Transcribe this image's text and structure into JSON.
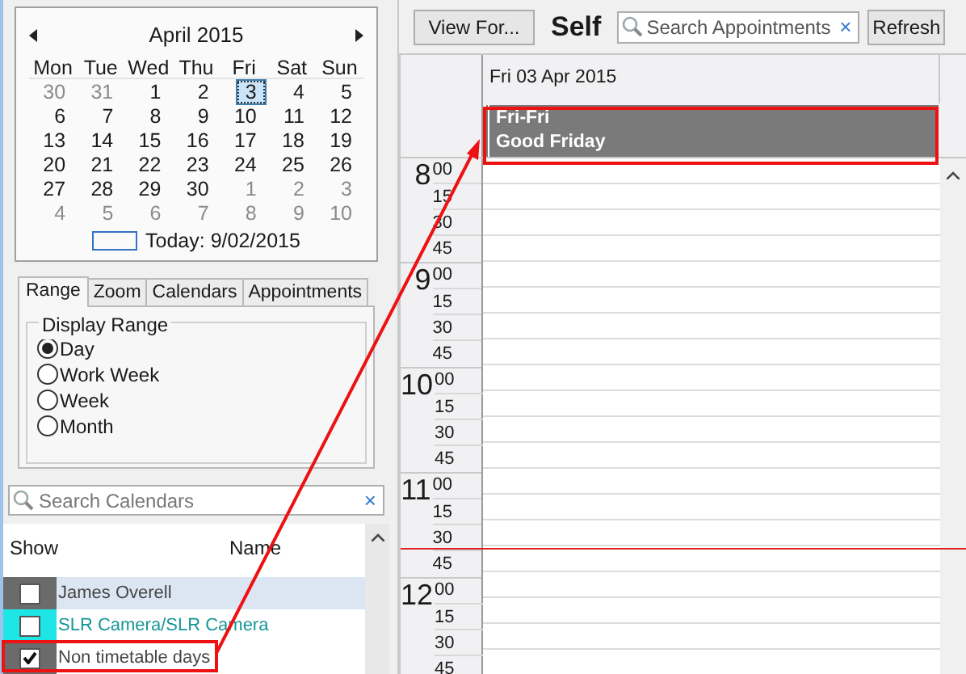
{
  "mini_calendar": {
    "month_label": "April 2015",
    "weekdays": [
      "Mon",
      "Tue",
      "Wed",
      "Thu",
      "Fri",
      "Sat",
      "Sun"
    ],
    "weeks": [
      [
        {
          "day": "30",
          "outside": true,
          "selected": false
        },
        {
          "day": "31",
          "outside": true,
          "selected": false
        },
        {
          "day": "1",
          "outside": false,
          "selected": false
        },
        {
          "day": "2",
          "outside": false,
          "selected": false
        },
        {
          "day": "3",
          "outside": false,
          "selected": true
        },
        {
          "day": "4",
          "outside": false,
          "selected": false
        },
        {
          "day": "5",
          "outside": false,
          "selected": false
        }
      ],
      [
        {
          "day": "6",
          "outside": false,
          "selected": false
        },
        {
          "day": "7",
          "outside": false,
          "selected": false
        },
        {
          "day": "8",
          "outside": false,
          "selected": false
        },
        {
          "day": "9",
          "outside": false,
          "selected": false
        },
        {
          "day": "10",
          "outside": false,
          "selected": false
        },
        {
          "day": "11",
          "outside": false,
          "selected": false
        },
        {
          "day": "12",
          "outside": false,
          "selected": false
        }
      ],
      [
        {
          "day": "13",
          "outside": false,
          "selected": false
        },
        {
          "day": "14",
          "outside": false,
          "selected": false
        },
        {
          "day": "15",
          "outside": false,
          "selected": false
        },
        {
          "day": "16",
          "outside": false,
          "selected": false
        },
        {
          "day": "17",
          "outside": false,
          "selected": false
        },
        {
          "day": "18",
          "outside": false,
          "selected": false
        },
        {
          "day": "19",
          "outside": false,
          "selected": false
        }
      ],
      [
        {
          "day": "20",
          "outside": false,
          "selected": false
        },
        {
          "day": "21",
          "outside": false,
          "selected": false
        },
        {
          "day": "22",
          "outside": false,
          "selected": false
        },
        {
          "day": "23",
          "outside": false,
          "selected": false
        },
        {
          "day": "24",
          "outside": false,
          "selected": false
        },
        {
          "day": "25",
          "outside": false,
          "selected": false
        },
        {
          "day": "26",
          "outside": false,
          "selected": false
        }
      ],
      [
        {
          "day": "27",
          "outside": false,
          "selected": false
        },
        {
          "day": "28",
          "outside": false,
          "selected": false
        },
        {
          "day": "29",
          "outside": false,
          "selected": false
        },
        {
          "day": "30",
          "outside": false,
          "selected": false
        },
        {
          "day": "1",
          "outside": true,
          "selected": false
        },
        {
          "day": "2",
          "outside": true,
          "selected": false
        },
        {
          "day": "3",
          "outside": true,
          "selected": false
        }
      ],
      [
        {
          "day": "4",
          "outside": true,
          "selected": false
        },
        {
          "day": "5",
          "outside": true,
          "selected": false
        },
        {
          "day": "6",
          "outside": true,
          "selected": false
        },
        {
          "day": "7",
          "outside": true,
          "selected": false
        },
        {
          "day": "8",
          "outside": true,
          "selected": false
        },
        {
          "day": "9",
          "outside": true,
          "selected": false
        },
        {
          "day": "10",
          "outside": true,
          "selected": false
        }
      ]
    ],
    "today_label": "Today: 9/02/2015"
  },
  "tabs": [
    {
      "label": "Range",
      "selected": true
    },
    {
      "label": "Zoom",
      "selected": false
    },
    {
      "label": "Calendars",
      "selected": false
    },
    {
      "label": "Appointments",
      "selected": false
    }
  ],
  "display_range": {
    "title": "Display Range",
    "options": [
      {
        "label": "Day",
        "selected": true
      },
      {
        "label": "Work Week",
        "selected": false
      },
      {
        "label": "Week",
        "selected": false
      },
      {
        "label": "Month",
        "selected": false
      }
    ]
  },
  "calendar_search": {
    "placeholder": "Search Calendars",
    "clear": "×"
  },
  "calendars": {
    "columns": [
      "Show",
      "Name"
    ],
    "items": [
      {
        "name": "James Overell",
        "checked": false,
        "selected": true,
        "color": "#6b6b6b"
      },
      {
        "name": "SLR Camera/SLR Camera",
        "checked": false,
        "selected": false,
        "color": "#1ee6e6"
      },
      {
        "name": "Non timetable days",
        "checked": true,
        "selected": false,
        "color": "#6b6b6b"
      }
    ]
  },
  "toolbar": {
    "view_button": "View For...",
    "owner": "Self",
    "search": {
      "placeholder": "Search Appointments",
      "clear": "×"
    },
    "refresh_button": "Refresh"
  },
  "day_view": {
    "date_header": "Fri 03 Apr 2015",
    "all_day_events": [
      {
        "time": "Fri-Fri",
        "title": "Good Friday",
        "color": "#7a7a7a"
      }
    ],
    "hours": [
      {
        "hour": "8",
        "minutes": [
          "00",
          "15",
          "30",
          "45"
        ]
      },
      {
        "hour": "9",
        "minutes": [
          "00",
          "15",
          "30",
          "45"
        ]
      },
      {
        "hour": "10",
        "minutes": [
          "00",
          "15",
          "30",
          "45"
        ]
      },
      {
        "hour": "11",
        "minutes": [
          "00",
          "15",
          "30",
          "45"
        ]
      },
      {
        "hour": "12",
        "minutes": [
          "00",
          "15",
          "30",
          "45"
        ]
      }
    ]
  }
}
